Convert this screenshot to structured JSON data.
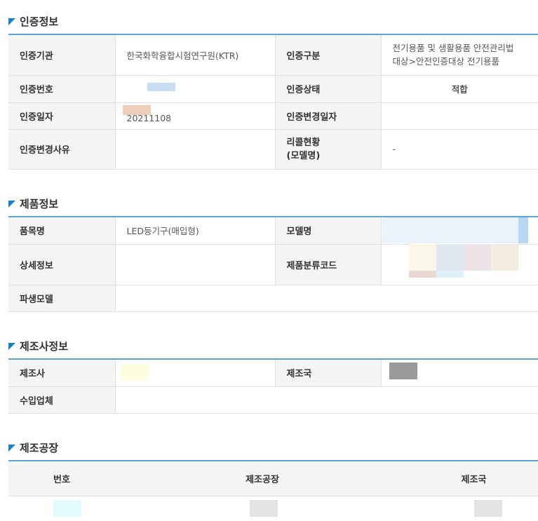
{
  "cert_section": {
    "title": "인증정보",
    "rows": {
      "agency_label": "인증기관",
      "agency_value": "한국화학융합시험연구원(KTR)",
      "category_label": "인증구분",
      "category_value_line1": "전기용품 및 생활용품 안전관리법",
      "category_value_line2": "대상>안전인증대상 전기용품",
      "number_label": "인증번호",
      "status_label": "인증상태",
      "status_value": "적합",
      "date_label": "인증일자",
      "date_value": "20211108",
      "change_date_label": "인증변경일자",
      "change_reason_label": "인증변경사유",
      "recall_label_line1": "리콜현황",
      "recall_label_line2": "(모델명)",
      "recall_value": "-"
    }
  },
  "product_section": {
    "title": "제품정보",
    "rows": {
      "name_label": "품목명",
      "name_value": "LED등기구(매입형)",
      "model_label": "모델명",
      "detail_label": "상세정보",
      "code_label": "제품분류코드",
      "derived_label": "파생모델"
    }
  },
  "maker_section": {
    "title": "제조사정보",
    "rows": {
      "maker_label": "제조사",
      "country_label": "제조국",
      "importer_label": "수입업체"
    }
  },
  "factory_section": {
    "title": "제조공장",
    "headers": [
      "번호",
      "제조공장",
      "제조국"
    ]
  }
}
